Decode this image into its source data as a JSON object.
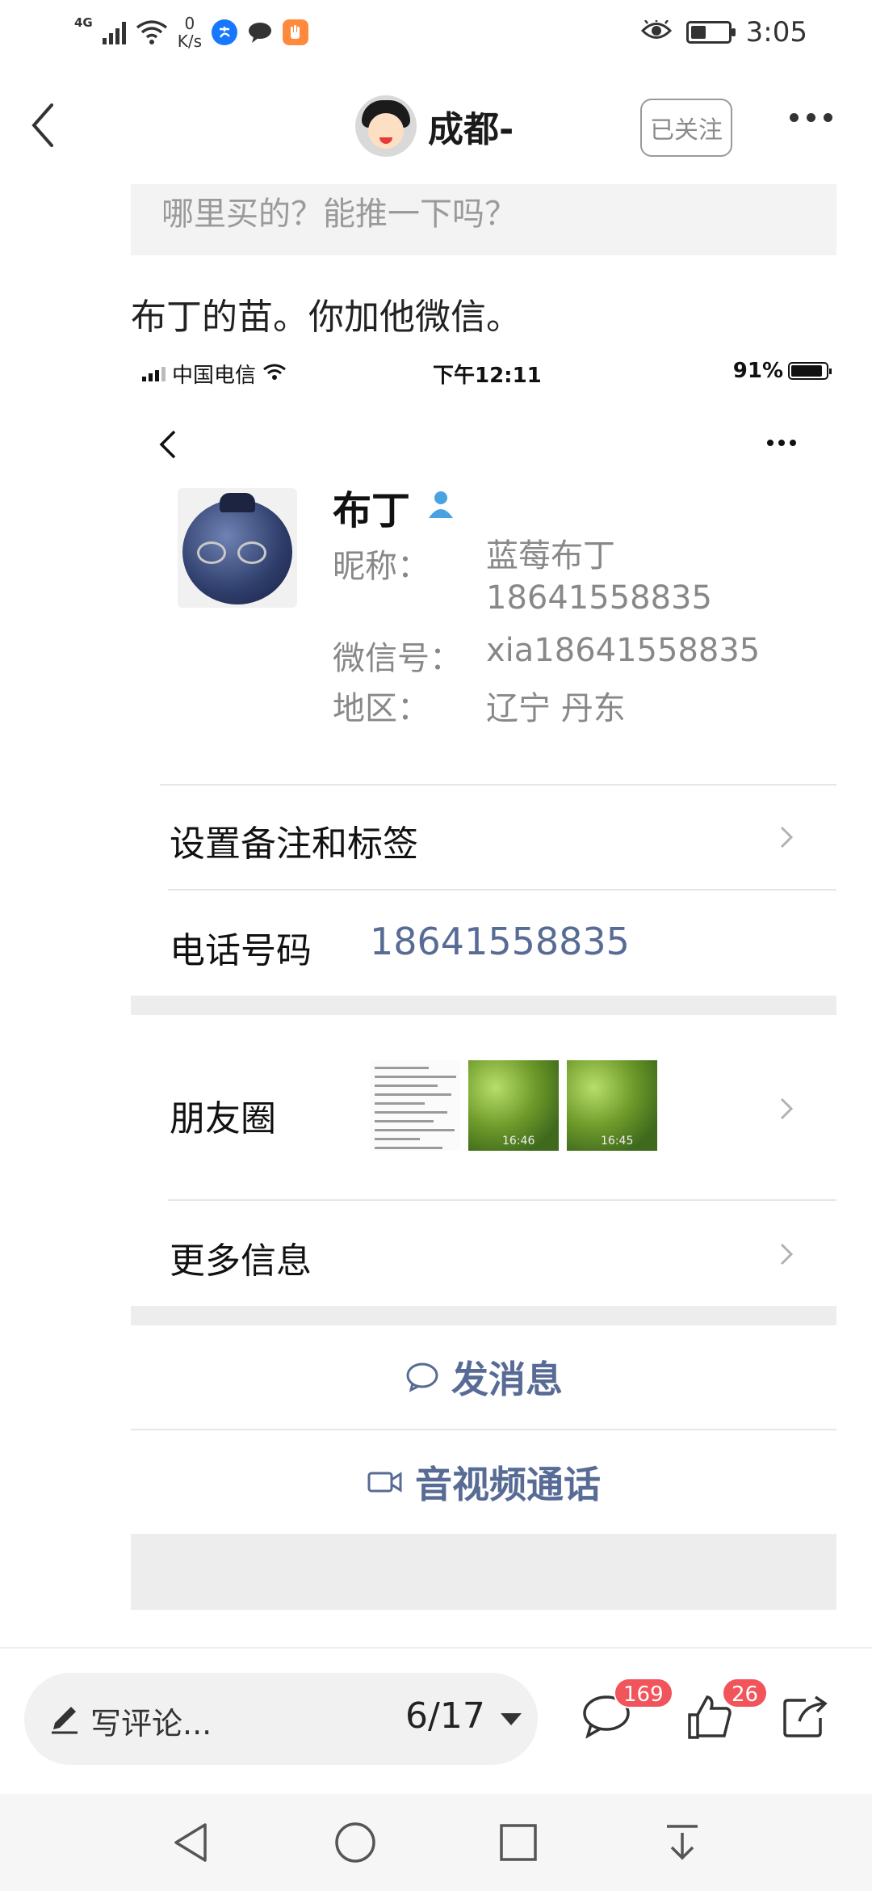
{
  "status_bar": {
    "network_type": "4G",
    "speed_value": "0",
    "speed_unit": "K/s",
    "time": "3:05",
    "battery_level": 0.4,
    "app_icons": [
      "alipay-icon",
      "chat-bubble-icon",
      "hand-icon"
    ],
    "icon_colors": {
      "alipay": "#1677ff",
      "chat": "#333333",
      "hand": "#ff8a3d"
    }
  },
  "header": {
    "title": "成都-",
    "follow_label": "已关注"
  },
  "article": {
    "quote": "哪里买的？能推一下吗？",
    "reply": "布丁的苗。你加他微信。"
  },
  "screenshot": {
    "status": {
      "carrier": "中国电信",
      "time": "下午12:11",
      "battery": "91%"
    },
    "profile": {
      "name": "布丁",
      "nickname_label": "昵称：",
      "nickname_line1": "蓝莓布丁",
      "nickname_line2": "18641558835",
      "wechat_label": "微信号：",
      "wechat_id": "xia18641558835",
      "region_label": "地区：",
      "region": "辽宁 丹东"
    },
    "rows": {
      "remark_label": "设置备注和标签",
      "phone_label": "电话号码",
      "phone_value": "18641558835",
      "moments_label": "朋友圈",
      "more_info_label": "更多信息"
    },
    "moments_timestamps": [
      "16:46",
      "16:45"
    ],
    "actions": {
      "message": "发消息",
      "call": "音视频通话"
    },
    "accent_color": "#576b95"
  },
  "comment_bar": {
    "placeholder": "写评论...",
    "page_indicator": "6/17",
    "comment_count": "169",
    "like_count": "26"
  }
}
